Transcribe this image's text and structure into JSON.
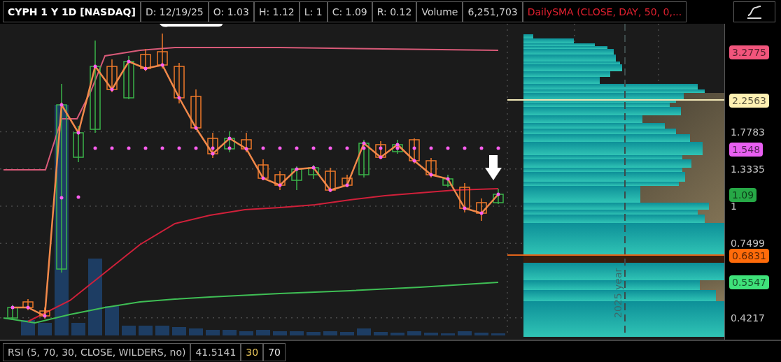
{
  "header": {
    "symbol": "CYPH 1 Y 1D [NASDAQ]",
    "fields": [
      "D: 12/19/25",
      "O: 1.03",
      "H: 1.12",
      "L: 1",
      "C: 1.09",
      "R: 0.12",
      "Volume",
      "6,251,703"
    ],
    "study": "DailySMA (CLOSE, DAY, 50, 0,..."
  },
  "price_axis": [
    "1.7783",
    "1.3335",
    "1",
    "0.7499",
    "0.4217"
  ],
  "price_badges": [
    {
      "value": "3.2775",
      "color": "#f2557c"
    },
    {
      "value": "2.2563",
      "color": "#fff1b3"
    },
    {
      "value": "1.548",
      "color": "#e95ff2"
    },
    {
      "value": "1.09",
      "color": "#26a846"
    },
    {
      "value": "0.6831",
      "color": "#ff6b0a"
    },
    {
      "value": "0.5547",
      "color": "#3fe27a"
    }
  ],
  "volume_profile_label": "2025 year",
  "rsi_bar": {
    "study": "RSI (5, 70, 30, CLOSE, WILDERS, no)",
    "value": "41.5141",
    "levels": [
      {
        "text": "30",
        "color": "#e8c55a"
      },
      {
        "text": "70",
        "color": "#e6e6e6"
      }
    ]
  }
}
